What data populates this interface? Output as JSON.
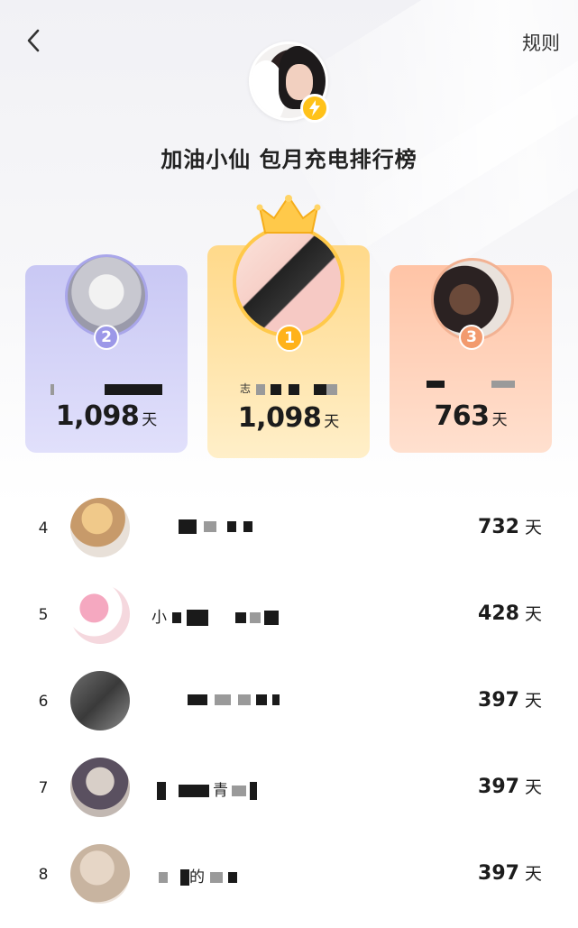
{
  "header": {
    "rules_label": "规则"
  },
  "title": "加油小仙 包月充电排行榜",
  "podium": [
    {
      "rank": "2",
      "name": "",
      "count": "1,098",
      "unit": "天"
    },
    {
      "rank": "1",
      "name": "志",
      "count": "1,098",
      "unit": "天"
    },
    {
      "rank": "3",
      "name": "",
      "count": "763",
      "unit": "天"
    }
  ],
  "list": [
    {
      "rank": "4",
      "name": "",
      "count": "732",
      "unit": "天"
    },
    {
      "rank": "5",
      "name": "小",
      "count": "428",
      "unit": "天"
    },
    {
      "rank": "6",
      "name": "",
      "count": "397",
      "unit": "天"
    },
    {
      "rank": "7",
      "name": "青",
      "count": "397",
      "unit": "天"
    },
    {
      "rank": "8",
      "name": "的",
      "count": "397",
      "unit": "天"
    }
  ],
  "colors": {
    "gold": "#ffc21a",
    "silver_card": "#c9c8f4",
    "bronze_card": "#ffc4a6"
  }
}
